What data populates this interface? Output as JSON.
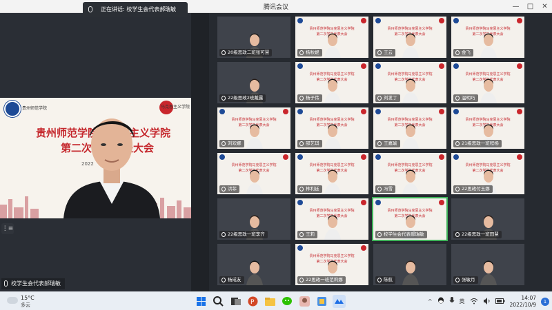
{
  "window": {
    "title": "腾讯会议",
    "buttons": [
      "—",
      "□",
      "✕"
    ]
  },
  "speaking": {
    "text": "正在讲话: 校学生会代表郝瑞敏"
  },
  "main_video": {
    "banner_left": "贵州师范学院",
    "banner_right": "马克思主义学院",
    "school_title": "贵州师范学院马克思主义学院",
    "conference_title": "第二次学生代表大会",
    "date": "2022",
    "speaker_label": "校学生会代表郝瑞敏",
    "handle_glyph": "⋮≡"
  },
  "tiles": [
    {
      "label": "20级思政二班张可慧",
      "style": "dark",
      "banner": false
    },
    {
      "label": "杨秋妮",
      "style": "bg",
      "banner": true
    },
    {
      "label": "王云",
      "style": "bg",
      "banner": true
    },
    {
      "label": "金飞",
      "style": "bg",
      "banner": true
    },
    {
      "label": "22级思政2班戴露",
      "style": "dark",
      "banner": false
    },
    {
      "label": "杨子伟",
      "style": "bg",
      "banner": true
    },
    {
      "label": "刘发丁",
      "style": "bg",
      "banner": true
    },
    {
      "label": "温明巧",
      "style": "bg",
      "banner": true
    },
    {
      "label": "刘欢娜",
      "style": "bg",
      "banner": true
    },
    {
      "label": "邵艺琪",
      "style": "bg",
      "banner": true
    },
    {
      "label": "王嘉瑜",
      "style": "bg",
      "banner": true
    },
    {
      "label": "21级思政一班程杨",
      "style": "bg",
      "banner": true
    },
    {
      "label": "洪菲",
      "style": "bg",
      "banner": true
    },
    {
      "label": "林利廷",
      "style": "bg",
      "banner": true
    },
    {
      "label": "冯雪",
      "style": "bg",
      "banner": true
    },
    {
      "label": "22思政付玉娜",
      "style": "bg",
      "banner": true
    },
    {
      "label": "22级思政一班李齐",
      "style": "dark",
      "banner": false
    },
    {
      "label": "王莉",
      "style": "bg",
      "banner": true
    },
    {
      "label": "校学生会代表郝瑞敏",
      "style": "bg",
      "banner": true
    },
    {
      "label": "22级思政一班田慧",
      "style": "dark",
      "banner": false
    },
    {
      "label": "杨成友",
      "style": "dark",
      "banner": false
    },
    {
      "label": "22思政一班范莉娜",
      "style": "bg",
      "banner": true
    },
    {
      "label": "陈航",
      "style": "dark",
      "banner": false
    },
    {
      "label": "张敏月",
      "style": "dark",
      "banner": false
    }
  ],
  "tile_banner": {
    "line1": "贵州师范学院马克思主义学院",
    "line2": "第二次学生代表大会"
  },
  "taskbar": {
    "temperature": "15°C",
    "condition": "多云",
    "ime": "英",
    "time": "14:07",
    "date": "2022/10/9",
    "notifications": "1",
    "caret": "^"
  },
  "colors": {
    "accent_red": "#c5282d",
    "school_blue": "#1e4a96",
    "active_speaker": "#3fb25a"
  }
}
